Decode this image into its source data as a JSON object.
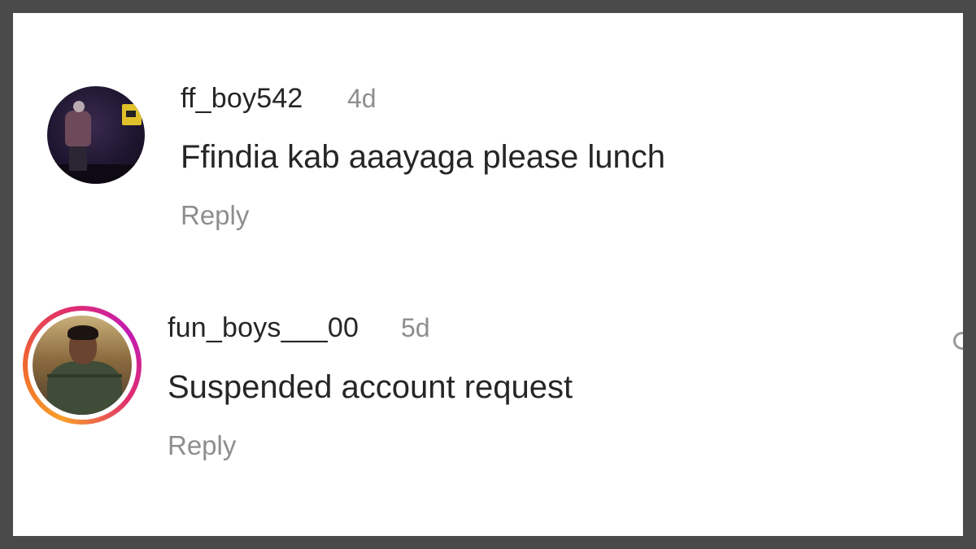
{
  "comments": [
    {
      "username": "ff_boy542",
      "time": "4d",
      "text": "Ffindia kab aaayaga please lunch",
      "reply_label": "Reply"
    },
    {
      "username": "fun_boys___00",
      "time": "5d",
      "text": "Suspended account request",
      "reply_label": "Reply",
      "has_story_ring": true
    }
  ],
  "colors": {
    "text_primary": "#262626",
    "text_secondary": "#8e8e8e",
    "story_ring": [
      "#f7a02a",
      "#e12f6c",
      "#c21bb0"
    ]
  },
  "icons": {
    "edge_partial": "like-heart-icon"
  }
}
